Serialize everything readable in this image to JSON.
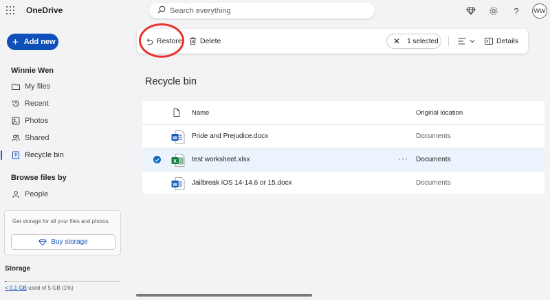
{
  "app": {
    "title": "OneDrive"
  },
  "search": {
    "placeholder": "Search everything"
  },
  "topbar": {
    "icons": [
      "diamond-icon",
      "gear-icon",
      "help-icon"
    ],
    "avatar_initials": "WW"
  },
  "sidebar": {
    "add_new_label": "Add new",
    "user_name": "Winnie Wen",
    "nav": [
      {
        "label": "My files",
        "icon": "folder-icon"
      },
      {
        "label": "Recent",
        "icon": "history-icon"
      },
      {
        "label": "Photos",
        "icon": "photo-icon"
      },
      {
        "label": "Shared",
        "icon": "people-icon"
      },
      {
        "label": "Recycle bin",
        "icon": "recycle-bin-icon",
        "active": true
      }
    ],
    "browse_title": "Browse files by",
    "browse": [
      {
        "label": "People",
        "icon": "person-icon"
      }
    ],
    "storage_promo": "Get storage for all your files and photos.",
    "buy_storage_label": "Buy storage",
    "storage_title": "Storage",
    "storage_used_link": "< 0.1 GB",
    "storage_used_rest": " used of 5 GB (1%)",
    "storage_fraction": 0.01
  },
  "commandbar": {
    "restore_label": "Restore",
    "delete_label": "Delete",
    "selected_label": "1 selected",
    "details_label": "Details"
  },
  "page": {
    "title": "Recycle bin"
  },
  "table": {
    "columns": [
      "Name",
      "Original location"
    ],
    "rows": [
      {
        "name": "Pride and Prejudice.docx",
        "location": "Documents",
        "type": "word",
        "selected": false
      },
      {
        "name": "test worksheet.xlsx",
        "location": "Documents",
        "type": "excel",
        "selected": true,
        "more": "···"
      },
      {
        "name": "Jailbreak iOS 14-14.6 or 15.docx",
        "location": "Documents",
        "type": "word",
        "selected": false
      }
    ]
  },
  "colors": {
    "accent": "#0f4fb8",
    "highlight_ring": "#e8322a",
    "word": "#185abd",
    "excel": "#107c41",
    "selected_row": "#ebf3fc"
  }
}
